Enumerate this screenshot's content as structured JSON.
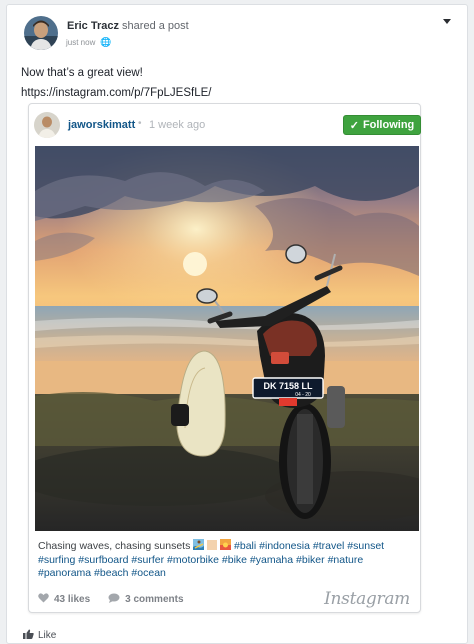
{
  "post": {
    "author": "Eric Tracz",
    "action": "shared a post",
    "timestamp": "just now",
    "privacy_icon": "globe-icon",
    "text": "Now that’s a great view!",
    "link": "https://instagram.com/p/7FpLJESfLE/"
  },
  "embed": {
    "username": "jaworskimatt",
    "separator": "•",
    "posted": "1 week ago",
    "follow_label": "Following",
    "caption_lead": "Chasing waves, chasing sunsets",
    "hashtags": [
      "#bali",
      "#indonesia",
      "#travel",
      "#sunset",
      "#surfing",
      "#surfboard",
      "#surfer",
      "#motorbike",
      "#bike",
      "#yamaha",
      "#biker",
      "#nature",
      "#panorama",
      "#beach",
      "#ocean"
    ],
    "likes": "43 likes",
    "comments": "3 comments",
    "brand": "Instagram",
    "plate_line1": "DK 7158 LL",
    "plate_line2": "04 - 20"
  },
  "footer": {
    "like_label": "Like"
  },
  "colors": {
    "follow_green": "#3fa33f",
    "hashtag_blue": "#125688"
  }
}
